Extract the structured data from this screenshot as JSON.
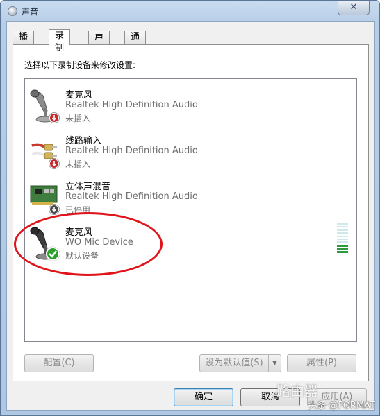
{
  "window": {
    "title": "声音",
    "close_glyph": "✕"
  },
  "tabs": [
    {
      "label": "播放",
      "active": false
    },
    {
      "label": "录制",
      "active": true
    },
    {
      "label": "声音",
      "active": false
    },
    {
      "label": "通信",
      "active": false
    }
  ],
  "instruction": "选择以下录制设备来修改设置:",
  "devices": [
    {
      "name": "麦克风",
      "driver": "Realtek High Definition Audio",
      "status": "未插入",
      "icon": "microphone-icon",
      "badge": "unplugged-badge-icon"
    },
    {
      "name": "线路输入",
      "driver": "Realtek High Definition Audio",
      "status": "未插入",
      "icon": "line-in-cable-icon",
      "badge": "unplugged-badge-icon"
    },
    {
      "name": "立体声混音",
      "driver": "Realtek High Definition Audio",
      "status": "已停用",
      "icon": "sound-card-icon",
      "badge": "disabled-badge-icon"
    },
    {
      "name": "麦克风",
      "driver": "WO Mic Device",
      "status": "默认设备",
      "icon": "microphone-icon",
      "badge": "default-check-icon"
    }
  ],
  "level_meter": {
    "bars_total": 10,
    "bars_on": 3
  },
  "buttons": {
    "configure": "配置(C)",
    "set_default": "设为默认值(S)",
    "properties": "属性(P)",
    "ok": "确定",
    "cancel": "取消",
    "apply": "应用(A)"
  },
  "watermark": {
    "logo": "路由器",
    "text": "头条 @FORMAT"
  },
  "colors": {
    "highlight": "#e0141b",
    "default_check": "#2aa02a",
    "unplugged_badge": "#c8262b",
    "meter_on": "#2d9b3c"
  }
}
